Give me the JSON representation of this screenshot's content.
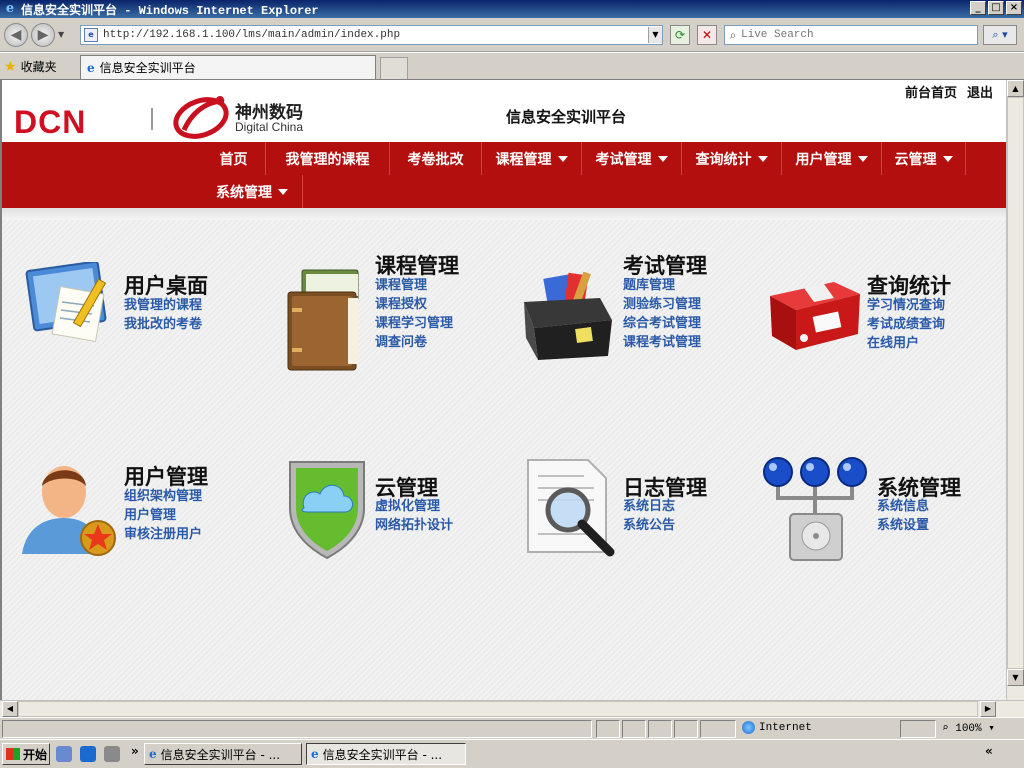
{
  "window": {
    "title": "信息安全实训平台 - Windows Internet Explorer",
    "buttons": {
      "minimize": "_",
      "maximize": "□",
      "close": "×"
    }
  },
  "browser": {
    "address": "http://192.168.1.100/lms/main/admin/index.php",
    "search_placeholder": "Live Search",
    "favorites_label": "收藏夹",
    "tab_title": "信息安全实训平台"
  },
  "site": {
    "logo_brand": "DCN",
    "logo_cn": "神州数码",
    "logo_en": "Digital China",
    "title": "信息安全实训平台",
    "top_links": [
      "前台首页",
      "退出"
    ]
  },
  "menu": [
    {
      "label": "首页",
      "dropdown": false
    },
    {
      "label": "我管理的课程",
      "dropdown": false
    },
    {
      "label": "考卷批改",
      "dropdown": false
    },
    {
      "label": "课程管理",
      "dropdown": true
    },
    {
      "label": "考试管理",
      "dropdown": true
    },
    {
      "label": "查询统计",
      "dropdown": true
    },
    {
      "label": "用户管理",
      "dropdown": true
    },
    {
      "label": "云管理",
      "dropdown": true
    },
    {
      "label": "系统管理",
      "dropdown": true
    }
  ],
  "modules": [
    {
      "title": "用户桌面",
      "icon": "desktop-icon",
      "links": [
        "我管理的课程",
        "我批改的考卷"
      ]
    },
    {
      "title": "课程管理",
      "icon": "books-icon",
      "links": [
        "课程管理",
        "课程授权",
        "课程学习管理",
        "调查问卷"
      ]
    },
    {
      "title": "考试管理",
      "icon": "toolbox-icon",
      "links": [
        "题库管理",
        "测验练习管理",
        "综合考试管理",
        "课程考试管理"
      ]
    },
    {
      "title": "查询统计",
      "icon": "red-box-icon",
      "links": [
        "学习情况查询",
        "考试成绩查询",
        "在线用户"
      ]
    },
    {
      "title": "用户管理",
      "icon": "user-star-icon",
      "links": [
        "组织架构管理",
        "用户管理",
        "审核注册用户"
      ]
    },
    {
      "title": "云管理",
      "icon": "cloud-shield-icon",
      "links": [
        "虚拟化管理",
        "网络拓扑设计"
      ]
    },
    {
      "title": "日志管理",
      "icon": "log-magnifier-icon",
      "links": [
        "系统日志",
        "系统公告"
      ]
    },
    {
      "title": "系统管理",
      "icon": "server-network-icon",
      "links": [
        "系统信息",
        "系统设置"
      ]
    }
  ],
  "statusbar": {
    "zone": "Internet",
    "zoom": "100%"
  },
  "taskbar": {
    "start": "开始",
    "tasks": [
      "信息安全实训平台 - ...",
      "信息安全实训平台 - ..."
    ]
  },
  "colors": {
    "nav_red": "#b40f0f",
    "link_blue": "#2a5aa8",
    "brand_red": "#d01020"
  }
}
